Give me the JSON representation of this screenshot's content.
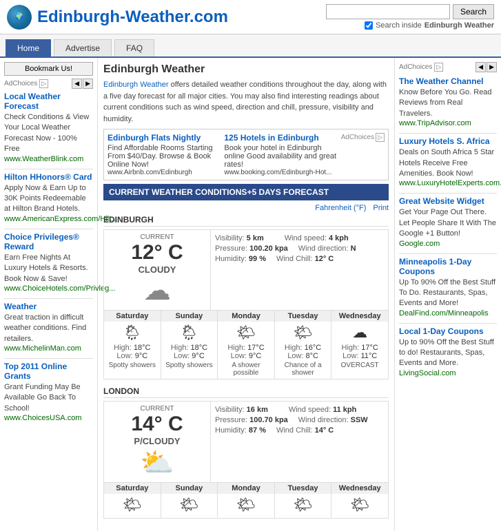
{
  "header": {
    "site_title": "Edinburgh-Weather.com",
    "search_placeholder": "",
    "search_button": "Search",
    "search_inside_label": "Search inside",
    "search_inside_site": "Edinburgh Weather"
  },
  "nav": {
    "tabs": [
      {
        "label": "Home",
        "active": true
      },
      {
        "label": "Advertise",
        "active": false
      },
      {
        "label": "FAQ",
        "active": false
      }
    ]
  },
  "left_sidebar": {
    "bookmark_button": "Bookmark Us!",
    "adchoices_label": "AdChoices",
    "ads": [
      {
        "title": "Local Weather Forecast",
        "text": "Check Conditions & View Your Local Weather Forecast Now - 100% Free",
        "link": "www.WeatherBlink.com"
      },
      {
        "title": "Hilton HHonors® Card",
        "text": "Apply Now & Earn Up to 30K Points Redeemable at Hilton Brand Hotels.",
        "link": "www.AmericanExpress.com/Hilt..."
      },
      {
        "title": "Choice Privileges® Reward",
        "text": "Earn Free Nights At Luxury Hotels & Resorts. Book Now & Save!",
        "link": "www.ChoiceHotels.com/Privleg..."
      },
      {
        "title": "Weather",
        "text": "Great traction in difficult weather conditions. Find retailers.",
        "link": "www.MichelinMan.com"
      },
      {
        "title": "Top 2011 Online Grants",
        "text": "Grant Funding May Be Available Go Back To School!",
        "link": "www.ChoicesUSA.com"
      }
    ],
    "free_nights_label": "Free Nights"
  },
  "center": {
    "page_title": "Edinburgh Weather",
    "intro": "Edinburgh Weather offers detailed weather conditions throughout the day, along with a five day forecast for all major cities. You may also find interesting readings about current conditions such as wind speed, direction and chill, pressure, visibility and humidity.",
    "intro_link": "Edinburgh Weather",
    "ad_banner": {
      "item1_title": "Edinburgh Flats Nightly",
      "item1_text": "Find Affordable Rooms Starting From $40/Day. Browse & Book Online Now!",
      "item1_link": "www.Airbnb.com/Edinburgh",
      "item2_title": "125 Hotels in Edinburgh",
      "item2_text": "Book your hotel in Edinburgh online Good availability and great rates!",
      "item2_link": "www.booking.com/Edinburgh-Hot..."
    },
    "weather_bar": "CURRENT WEATHER CONDITIONS+5 DAYS FORECAST",
    "forecast_links": {
      "fahrenheit": "Fahrenheit (°F)",
      "print": "Print"
    },
    "cities": [
      {
        "name": "EDINBURGH",
        "current": {
          "label": "CURRENT",
          "temp": "12° C",
          "condition": "CLOUDY",
          "icon": "☁",
          "visibility_label": "Visibility:",
          "visibility_value": "5 km",
          "pressure_label": "Pressure:",
          "pressure_value": "100.20 kpa",
          "humidity_label": "Humidity:",
          "humidity_value": "99 %",
          "wind_speed_label": "Wind speed:",
          "wind_speed_value": "4 kph",
          "wind_direction_label": "Wind direction:",
          "wind_direction_value": "N",
          "wind_chill_label": "Wind Chill:",
          "wind_chill_value": "12° C"
        },
        "forecast": [
          {
            "day": "Saturday",
            "high": "18°C",
            "low": "9°C",
            "desc": "Spotty showers",
            "icon": "🌦"
          },
          {
            "day": "Sunday",
            "high": "18°C",
            "low": "9°C",
            "desc": "Spotty showers",
            "icon": "🌦"
          },
          {
            "day": "Monday",
            "high": "17°C",
            "low": "9°C",
            "desc": "A shower possible",
            "icon": "🌤"
          },
          {
            "day": "Tuesday",
            "high": "16°C",
            "low": "8°C",
            "desc": "Chance of a shower",
            "icon": "🌤"
          },
          {
            "day": "Wednesday",
            "high": "17°C",
            "low": "11°C",
            "desc": "OVERCAST",
            "icon": "☁"
          }
        ]
      },
      {
        "name": "LONDON",
        "current": {
          "label": "CURRENT",
          "temp": "14° C",
          "condition": "P/CLOUDY",
          "icon": "⛅",
          "visibility_label": "Visibility:",
          "visibility_value": "16 km",
          "pressure_label": "Pressure:",
          "pressure_value": "100.70 kpa",
          "humidity_label": "Humidity:",
          "humidity_value": "87 %",
          "wind_speed_label": "Wind speed:",
          "wind_speed_value": "11 kph",
          "wind_direction_label": "Wind direction:",
          "wind_direction_value": "SSW",
          "wind_chill_label": "Wind Chill:",
          "wind_chill_value": "14° C"
        },
        "forecast": [
          {
            "day": "Saturday",
            "high": "",
            "low": "",
            "desc": "",
            "icon": "🌤"
          },
          {
            "day": "Sunday",
            "high": "",
            "low": "",
            "desc": "",
            "icon": "🌤"
          },
          {
            "day": "Monday",
            "high": "",
            "low": "",
            "desc": "",
            "icon": "🌤"
          },
          {
            "day": "Tuesday",
            "high": "",
            "low": "",
            "desc": "",
            "icon": "🌤"
          },
          {
            "day": "Wednesday",
            "high": "",
            "low": "",
            "desc": "",
            "icon": "🌤"
          }
        ]
      }
    ]
  },
  "right_sidebar": {
    "adchoices_label": "AdChoices",
    "ads": [
      {
        "title": "The Weather Channel",
        "text": "Know Before You Go. Read Reviews from Real Travelers.",
        "link": "www.TripAdvisor.com"
      },
      {
        "title": "Luxury Hotels S. Africa",
        "text": "Deals on South Africa 5 Star Hotels Receive Free Amenities. Book Now!",
        "link": "www.LuxuryHotelExperts.com...."
      },
      {
        "title": "Great Website Widget",
        "text": "Get Your Page Out There. Let People Share It With The Google +1 Button!",
        "link": "Google.com"
      },
      {
        "title": "Minneapolis 1-Day Coupons",
        "text": "Up To 90% Off the Best Stuff To Do. Restaurants, Spas, Events and More!",
        "link": "DealFind.com/Minneapolis"
      },
      {
        "title": "Local 1-Day Coupons",
        "text": "Up to 90% Off the Best Stuff to do! Restaurants, Spas, Events and More.",
        "link": "LivingSocial.com"
      }
    ]
  }
}
